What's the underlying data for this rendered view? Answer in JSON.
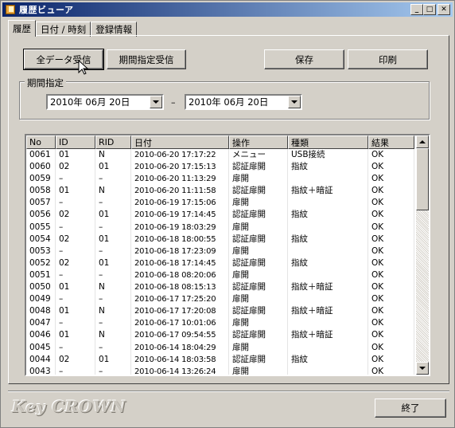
{
  "window": {
    "title": "履歴ビューア",
    "minimize_glyph": "_",
    "maximize_glyph": "□",
    "close_glyph": "✕"
  },
  "tabs": [
    {
      "label": "履歴",
      "active": true
    },
    {
      "label": "日付 / 時刻",
      "active": false
    },
    {
      "label": "登録情報",
      "active": false
    }
  ],
  "toolbar": {
    "receive_all_label": "全データ受信",
    "receive_period_label": "期間指定受信",
    "save_label": "保存",
    "print_label": "印刷"
  },
  "period": {
    "legend": "期間指定",
    "from_date": "2010年 06月 20日",
    "separator": "–",
    "to_date": "2010年 06月 20日"
  },
  "table": {
    "columns": [
      "No",
      "ID",
      "RID",
      "日付",
      "操作",
      "種類",
      "結果"
    ],
    "rows": [
      [
        "0061",
        "01",
        "N",
        "2010-06-20 17:17:22",
        "メニュー",
        "USB接続",
        "OK"
      ],
      [
        "0060",
        "02",
        "01",
        "2010-06-20 17:15:13",
        "認証扉開",
        "指紋",
        "OK"
      ],
      [
        "0059",
        "–",
        "–",
        "2010-06-20 11:13:29",
        "扉開",
        "",
        "OK"
      ],
      [
        "0058",
        "01",
        "N",
        "2010-06-20 11:11:58",
        "認証扉開",
        "指紋＋暗証",
        "OK"
      ],
      [
        "0057",
        "–",
        "–",
        "2010-06-19 17:15:06",
        "扉開",
        "",
        "OK"
      ],
      [
        "0056",
        "02",
        "01",
        "2010-06-19 17:14:45",
        "認証扉開",
        "指紋",
        "OK"
      ],
      [
        "0055",
        "–",
        "–",
        "2010-06-19 18:03:29",
        "扉開",
        "",
        "OK"
      ],
      [
        "0054",
        "02",
        "01",
        "2010-06-18 18:00:55",
        "認証扉開",
        "指紋",
        "OK"
      ],
      [
        "0053",
        "–",
        "–",
        "2010-06-18 17:23:09",
        "扉開",
        "",
        "OK"
      ],
      [
        "0052",
        "02",
        "01",
        "2010-06-18 17:14:45",
        "認証扉開",
        "指紋",
        "OK"
      ],
      [
        "0051",
        "–",
        "–",
        "2010-06-18 08:20:06",
        "扉開",
        "",
        "OK"
      ],
      [
        "0050",
        "01",
        "N",
        "2010-06-18 08:15:13",
        "認証扉開",
        "指紋＋暗証",
        "OK"
      ],
      [
        "0049",
        "–",
        "–",
        "2010-06-17 17:25:20",
        "扉開",
        "",
        "OK"
      ],
      [
        "0048",
        "01",
        "N",
        "2010-06-17 17:20:08",
        "認証扉開",
        "指紋＋暗証",
        "OK"
      ],
      [
        "0047",
        "–",
        "–",
        "2010-06-17 10:01:06",
        "扉開",
        "",
        "OK"
      ],
      [
        "0046",
        "01",
        "N",
        "2010-06-17 09:54:55",
        "認証扉開",
        "指紋＋暗証",
        "OK"
      ],
      [
        "0045",
        "–",
        "–",
        "2010-06-14 18:04:29",
        "扉開",
        "",
        "OK"
      ],
      [
        "0044",
        "02",
        "01",
        "2010-06-14 18:03:58",
        "認証扉開",
        "指紋",
        "OK"
      ],
      [
        "0043",
        "–",
        "–",
        "2010-06-14 13:26:24",
        "扉開",
        "",
        "OK"
      ]
    ]
  },
  "footer": {
    "brand": "Key CROWN",
    "exit_label": "終了"
  },
  "icons": {
    "app": "book-icon",
    "cursor": "mouse-pointer-icon"
  }
}
